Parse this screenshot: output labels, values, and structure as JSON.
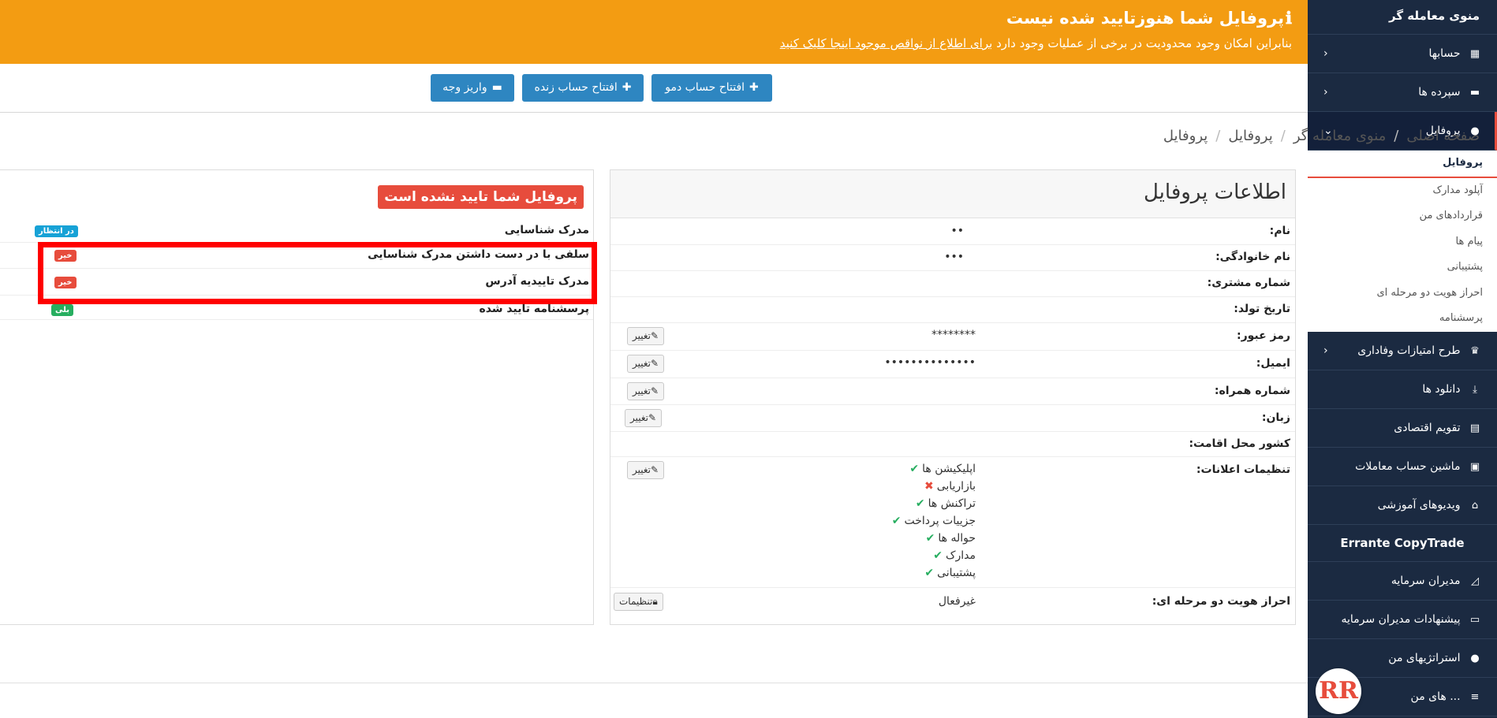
{
  "sidebar": {
    "title": "منوی معامله گر",
    "items": [
      {
        "label": "حسابها",
        "icon": "building-icon"
      },
      {
        "label": "سپرده ها",
        "icon": "wallet-icon"
      },
      {
        "label": "پروفایل",
        "icon": "user-icon"
      }
    ],
    "profile_sub": [
      "پروفایل",
      "آپلود مدارک",
      "قراردادهای من",
      "پیام ها",
      "پشتیبانی",
      "احراز هویت دو مرحله ای",
      "پرسشنامه"
    ],
    "items2": [
      {
        "label": "طرح امتیازات وفاداری",
        "icon": "trophy-icon"
      },
      {
        "label": "دانلود ها",
        "icon": "download-icon"
      },
      {
        "label": "تقویم اقتصادی",
        "icon": "calendar-icon"
      },
      {
        "label": "ماشین حساب معاملات",
        "icon": "calculator-icon"
      },
      {
        "label": "ویدیوهای آموزشی",
        "icon": "bank-icon"
      }
    ],
    "section": "Errante CopyTrade",
    "items3": [
      {
        "label": "مدیران سرمایه",
        "icon": "chart-icon"
      },
      {
        "label": "پیشنهادات مدیران سرمایه",
        "icon": "card-icon"
      },
      {
        "label": "استراتژیهای من",
        "icon": "user-icon"
      },
      {
        "label": "... های من",
        "icon": "list-icon"
      }
    ],
    "logo": "RR"
  },
  "banner": {
    "title": "پروفایل شما هنوزتایید شده نیست",
    "message": "بنابراین امکان وجود محدودیت در برخی از عملیات وجود دارد ",
    "link": "برای اطلاع از نواقص موجود اینجا کلیک کنید"
  },
  "actions": {
    "demo": "افتتاح حساب دمو",
    "live": "افتتاح حساب زنده",
    "deposit": "واریز وجه"
  },
  "breadcrumb": [
    "صفحه اصلی",
    "منوی معامله گر",
    "پروفایل",
    "پروفایل"
  ],
  "profile": {
    "title": "اطلاعات پروفایل",
    "labels": {
      "name": "نام:",
      "family": "نام خانوادگی:",
      "customer": "شماره مشتری:",
      "birth": "تاریخ تولد:",
      "password": "رمز عبور:",
      "email": "ایمیل:",
      "mobile": "شماره همراه:",
      "language": "زبان:",
      "country": "کشور محل اقامت:",
      "notifications": "تنظیمات اعلانات:",
      "twofa": "احراز هویت دو مرحله ای:"
    },
    "password_value": "********",
    "change_label": "تغییر",
    "notifications": [
      {
        "label": "اپلیکیشن ها",
        "on": true
      },
      {
        "label": "بازاریابی",
        "on": false
      },
      {
        "label": "تراکنش ها",
        "on": true
      },
      {
        "label": "جزییات پرداخت",
        "on": true
      },
      {
        "label": "حواله ها",
        "on": true
      },
      {
        "label": "مدارک",
        "on": true
      },
      {
        "label": "پشتیبانی",
        "on": true
      }
    ],
    "twofa_value": "غیرفعال",
    "settings_label": "تنظیمات"
  },
  "documents": {
    "title": "پروفایل شما تایید نشده است",
    "rows": [
      {
        "label": "مدرک شناسایی",
        "status": "در انتظار"
      },
      {
        "label": "سلفی با در دست داشتن مدرک شناسایی",
        "status": "خیر"
      },
      {
        "label": "مدرک تاییدیه آدرس",
        "status": "خیر"
      },
      {
        "label": "پرسشنامه تایید شده",
        "status": "بلی"
      }
    ]
  },
  "colors": {
    "banner": "#f39c12",
    "sidebar": "#1b2a41",
    "button": "#2e86c1",
    "danger": "#e74c3c",
    "success": "#27ae60"
  }
}
